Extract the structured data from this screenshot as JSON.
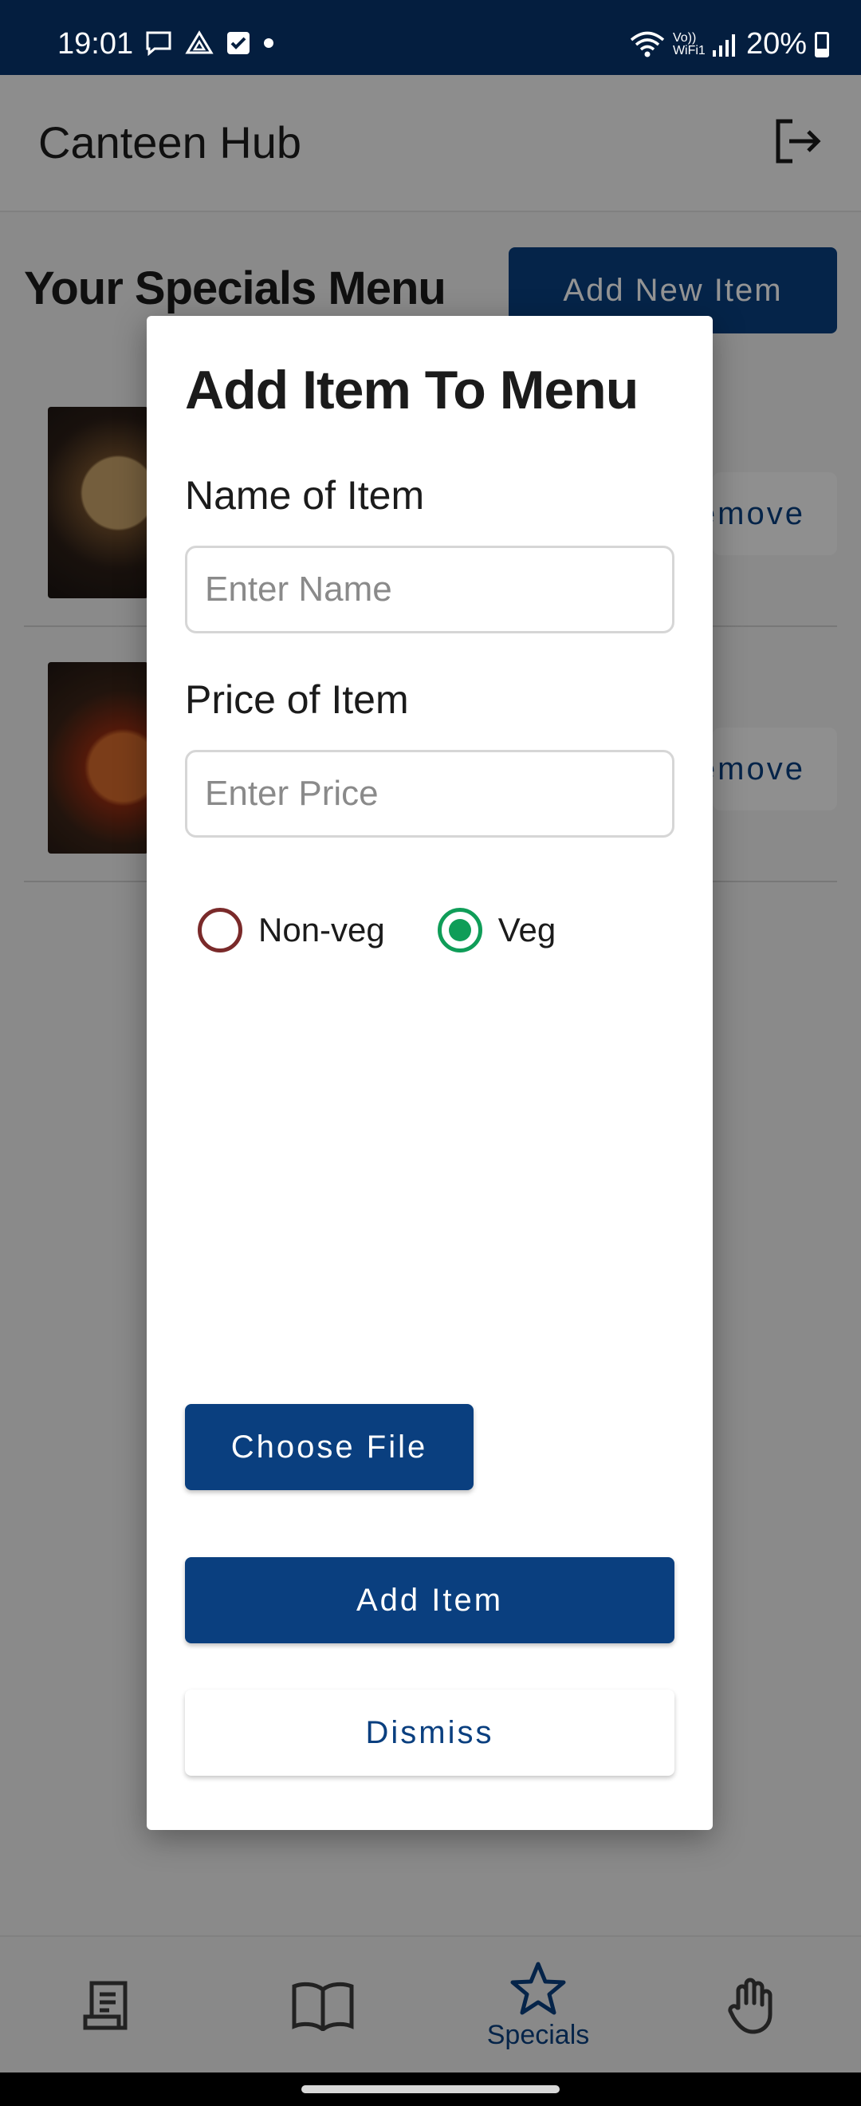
{
  "status_bar": {
    "time": "19:01",
    "network": "Vo)) WiFi1",
    "battery": "20%"
  },
  "header": {
    "title": "Canteen Hub",
    "logout_icon": "logout-icon"
  },
  "page": {
    "title": "Your Specials Menu",
    "add_new_label": "Add New Item",
    "rows": [
      {
        "remove_label": "Remove"
      },
      {
        "remove_label": "Remove"
      }
    ]
  },
  "dialog": {
    "title": "Add Item To Menu",
    "name_label": "Name of Item",
    "name_placeholder": "Enter Name",
    "price_label": "Price of Item",
    "price_placeholder": "Enter Price",
    "radio_options": [
      {
        "label": "Non-veg",
        "selected": false,
        "color": "#7a2a2a"
      },
      {
        "label": "Veg",
        "selected": true,
        "color": "#0f9d58"
      }
    ],
    "choose_file_label": "Choose File",
    "add_item_label": "Add Item",
    "dismiss_label": "Dismiss"
  },
  "bottom_nav": {
    "items": [
      {
        "icon": "orders-icon",
        "label": ""
      },
      {
        "icon": "menu-book-icon",
        "label": ""
      },
      {
        "icon": "star-icon",
        "label": "Specials",
        "active": true
      },
      {
        "icon": "hand-icon",
        "label": ""
      }
    ]
  },
  "colors": {
    "primary": "#0a3f7f",
    "status_bar": "#041e3f",
    "veg": "#0f9d58",
    "nonveg": "#7a2a2a"
  }
}
